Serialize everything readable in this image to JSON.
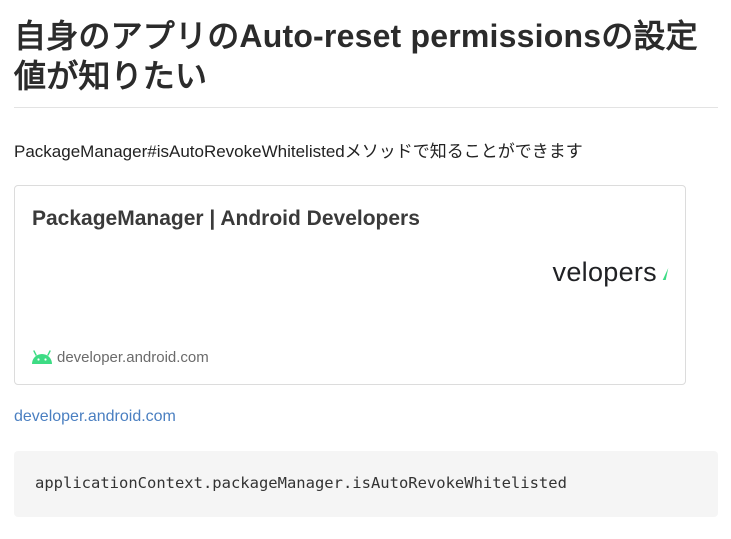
{
  "article": {
    "title": "自身のアプリのAuto-reset permissionsの設定値が知りたい",
    "body_text": "PackageManager#isAutoRevokeWhitelistedメソッドで知ることができます",
    "link_text": "developer.android.com",
    "code": "applicationContext.packageManager.isAutoRevokeWhitelisted"
  },
  "link_card": {
    "title": "PackageManager  |  Android Developers",
    "brand_text": "velopers",
    "domain": "developer.android.com",
    "icon": "android-icon",
    "accent_color": "#3ddc84"
  },
  "colors": {
    "link": "#4a7fc1",
    "code_background": "#f5f5f5",
    "card_border": "#dcdcdc"
  }
}
